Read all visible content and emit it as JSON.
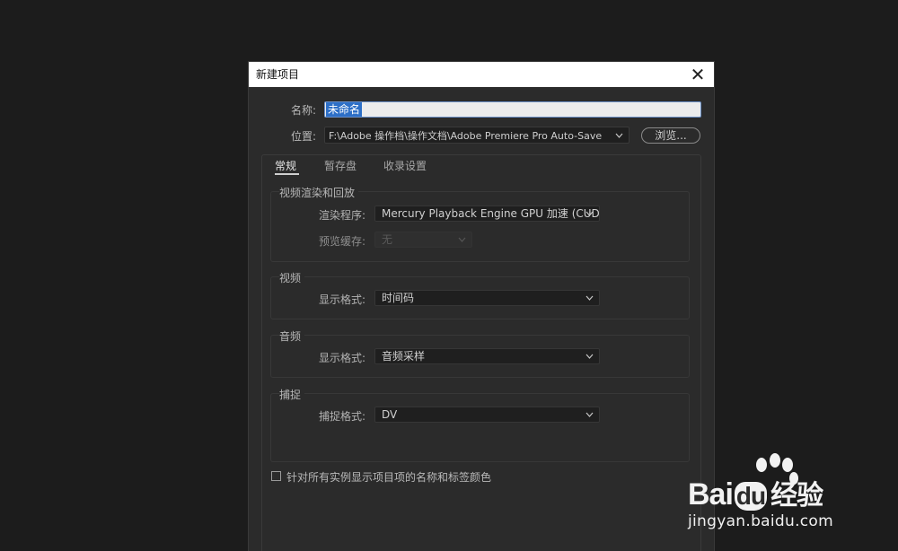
{
  "dialog": {
    "title": "新建项目",
    "close_glyph": "✕"
  },
  "project": {
    "name_label": "名称:",
    "name_value": "未命名",
    "location_label": "位置:",
    "location_value": "F:\\Adobe 操作档\\操作文档\\Adobe Premiere Pro Auto-Save",
    "browse_label": "浏览..."
  },
  "tabs": [
    {
      "label": "常规",
      "active": true
    },
    {
      "label": "暂存盘",
      "active": false
    },
    {
      "label": "收录设置",
      "active": false
    }
  ],
  "video_rendering": {
    "title": "视频渲染和回放",
    "renderer_label": "渲染程序:",
    "renderer_value": "Mercury Playback Engine GPU 加速 (CUDA)",
    "preview_cache_label": "预览缓存:",
    "preview_cache_value": "无"
  },
  "video": {
    "title": "视频",
    "display_format_label": "显示格式:",
    "display_format_value": "时间码"
  },
  "audio": {
    "title": "音频",
    "display_format_label": "显示格式:",
    "display_format_value": "音频采样"
  },
  "capture": {
    "title": "捕捉",
    "capture_format_label": "捕捉格式:",
    "capture_format_value": "DV"
  },
  "options": {
    "show_names_label": "针对所有实例显示项目项的名称和标签颜色",
    "show_names_checked": false
  },
  "watermark": {
    "logo_text_1": "Bai",
    "logo_text_2": "du",
    "logo_text_3": "经验",
    "url": "jingyan.baidu.com"
  },
  "icons": {
    "dropdown": "chevron-down-icon",
    "close": "close-icon"
  }
}
